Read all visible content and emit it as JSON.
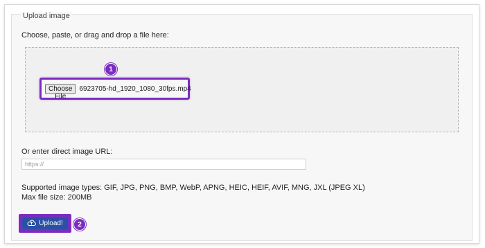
{
  "fieldset": {
    "legend": "Upload image"
  },
  "dropzone": {
    "instruction": "Choose, paste, or drag and drop a file here:",
    "choose_file_label": "Choose File",
    "selected_file": "6923705-hd_1920_1080_30fps.mp4",
    "step_badge": "1"
  },
  "url": {
    "label": "Or enter direct image URL:",
    "placeholder": "https://",
    "value": ""
  },
  "info": {
    "supported_types": "Supported image types: GIF, JPG, PNG, BMP, WebP, APNG, HEIC, HEIF, AVIF, MNG, JXL (JPEG XL)",
    "max_size": "Max file size: 200MB"
  },
  "upload": {
    "label": "Upload!",
    "icon": "cloud-upload-icon",
    "step_badge": "2"
  },
  "colors": {
    "highlight": "#7b2cc0",
    "button": "#2a4fa6"
  }
}
